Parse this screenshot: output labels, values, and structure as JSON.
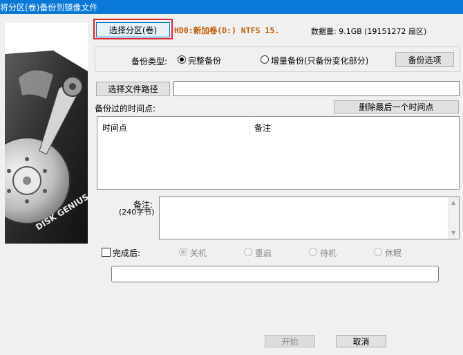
{
  "window": {
    "title": "将分区(卷)备份到镜像文件"
  },
  "source": {
    "select_button": "选择分区(卷)",
    "partition": "HD0:新加卷(D:) NTFS 15.",
    "capacity": "数据量: 9.1GB (19151272 扇区)"
  },
  "backup_type": {
    "label": "备份类型:",
    "full": "完整备份",
    "incremental": "增量备份(只备份变化部分)",
    "options_button": "备份选项",
    "selected": "full"
  },
  "file": {
    "select_path_button": "选择文件路径",
    "path_value": ""
  },
  "timepoints": {
    "label": "备份过的时间点:",
    "delete_last_button": "删除最后一个时间点",
    "columns": [
      "时间点",
      "备注"
    ]
  },
  "memo": {
    "label": "备注:",
    "sublabel": "(240字节)",
    "value": ""
  },
  "after_completion": {
    "label": "完成后:",
    "options": [
      "关机",
      "重启",
      "待机",
      "休眠"
    ],
    "selected": "关机",
    "checked": false
  },
  "progress": {
    "value": 0
  },
  "actions": {
    "start_button": "开始",
    "cancel_button": "取消"
  },
  "image": {
    "brand_text": "DISK GENIUS"
  }
}
